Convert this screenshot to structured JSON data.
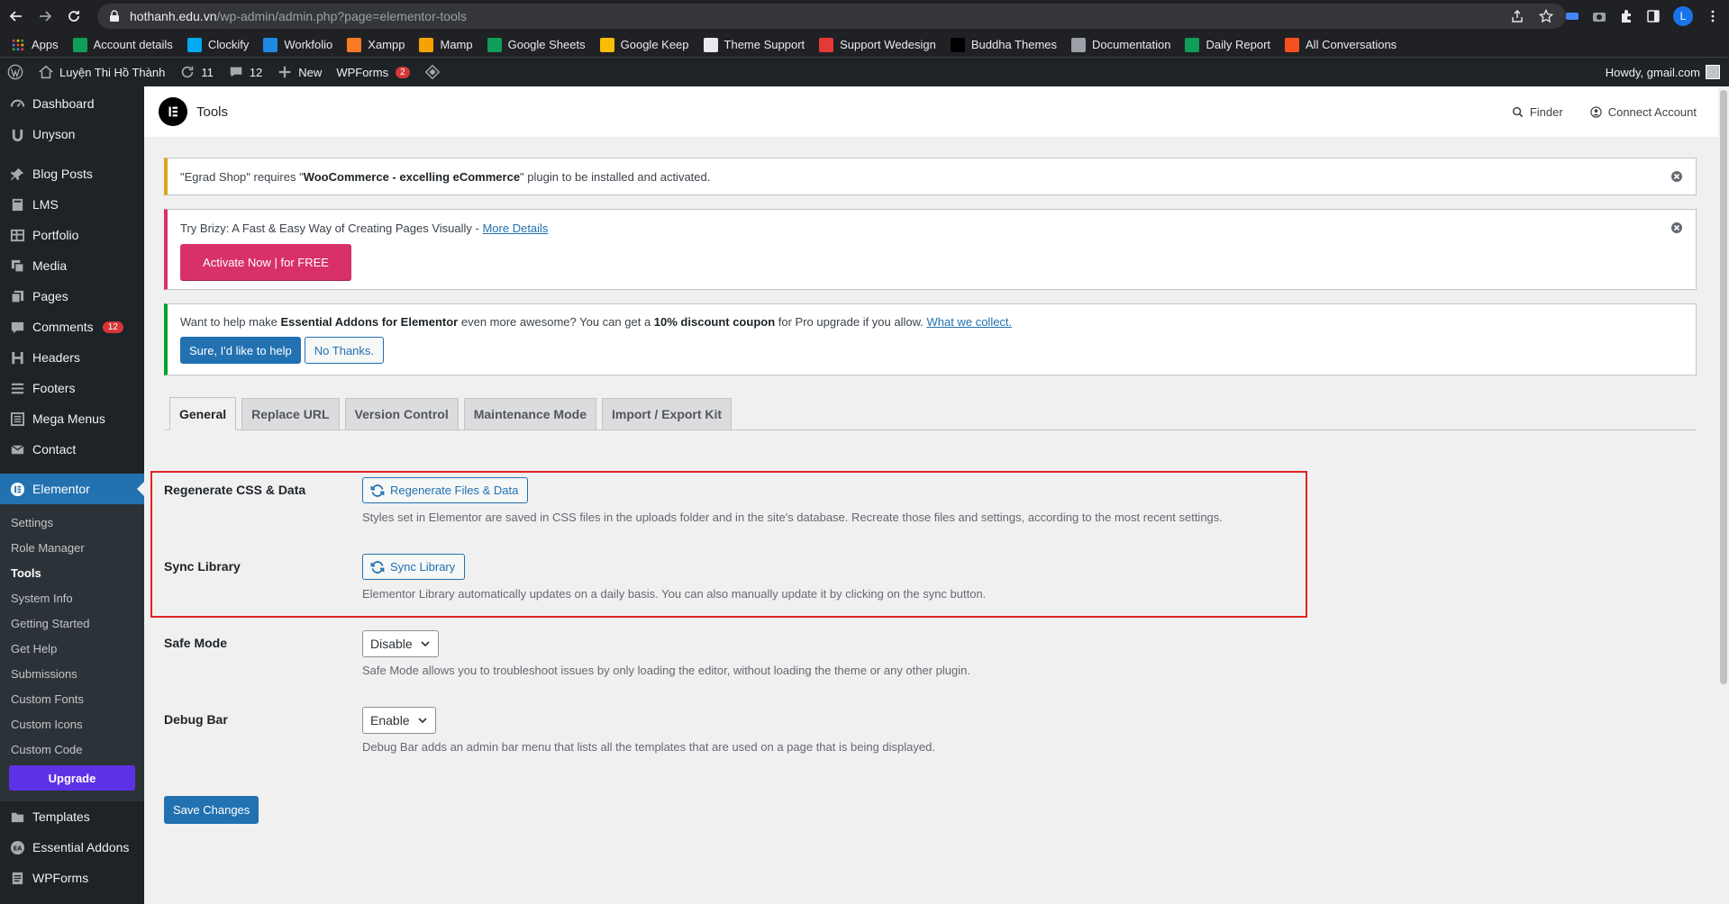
{
  "browser": {
    "url_host": "hothanh.edu.vn",
    "url_path": "/wp-admin/admin.php?page=elementor-tools",
    "profile_initial": "L"
  },
  "bookmarks": [
    {
      "label": "Apps",
      "icon": "apps-grid-icon",
      "color": "#ea4335"
    },
    {
      "label": "Account details",
      "icon": "sheets-icon",
      "color": "#0f9d58"
    },
    {
      "label": "Clockify",
      "icon": "clockify-icon",
      "color": "#03a9f4"
    },
    {
      "label": "Workfolio",
      "icon": "workfolio-icon",
      "color": "#1e88e5"
    },
    {
      "label": "Xampp",
      "icon": "xampp-icon",
      "color": "#fb7a24"
    },
    {
      "label": "Mamp",
      "icon": "mamp-icon",
      "color": "#f4a300"
    },
    {
      "label": "Google Sheets",
      "icon": "sheets-icon",
      "color": "#0f9d58"
    },
    {
      "label": "Google Keep",
      "icon": "keep-icon",
      "color": "#fbbc04"
    },
    {
      "label": "Theme Support",
      "icon": "wordpress-icon",
      "color": "#e8eaed"
    },
    {
      "label": "Support Wedesign",
      "icon": "wedesign-icon",
      "color": "#e53935"
    },
    {
      "label": "Buddha Themes",
      "icon": "buddha-icon",
      "color": "#000000"
    },
    {
      "label": "Documentation",
      "icon": "globe-icon",
      "color": "#9aa0a6"
    },
    {
      "label": "Daily Report",
      "icon": "sheets-icon",
      "color": "#0f9d58"
    },
    {
      "label": "All Conversations",
      "icon": "chat-icon",
      "color": "#f4511e"
    }
  ],
  "adminbar": {
    "site_name": "Luyện Thi Hồ Thành",
    "updates_count": "11",
    "comments_count": "12",
    "new_label": "New",
    "wpforms_label": "WPForms",
    "wpforms_badge": "2",
    "howdy": "Howdy, gmail.com"
  },
  "sidebar": {
    "items_top": [
      {
        "label": "Dashboard",
        "icon": "dashboard-icon"
      },
      {
        "label": "Unyson",
        "icon": "unyson-icon"
      }
    ],
    "items_mid": [
      {
        "label": "Blog Posts",
        "icon": "pin-icon"
      },
      {
        "label": "LMS",
        "icon": "book-icon"
      },
      {
        "label": "Portfolio",
        "icon": "portfolio-icon"
      },
      {
        "label": "Media",
        "icon": "media-icon"
      },
      {
        "label": "Pages",
        "icon": "pages-icon"
      },
      {
        "label": "Comments",
        "icon": "comments-icon",
        "badge": "12"
      },
      {
        "label": "Headers",
        "icon": "header-icon"
      },
      {
        "label": "Footers",
        "icon": "footer-icon"
      },
      {
        "label": "Mega Menus",
        "icon": "menu-icon"
      },
      {
        "label": "Contact",
        "icon": "mail-icon"
      }
    ],
    "active": {
      "label": "Elementor",
      "icon": "elementor-icon"
    },
    "submenu": [
      "Settings",
      "Role Manager",
      "Tools",
      "System Info",
      "Getting Started",
      "Get Help",
      "Submissions",
      "Custom Fonts",
      "Custom Icons",
      "Custom Code"
    ],
    "submenu_current": "Tools",
    "upgrade_label": "Upgrade",
    "items_bottom": [
      {
        "label": "Templates",
        "icon": "folder-icon"
      },
      {
        "label": "Essential Addons",
        "icon": "ea-icon"
      },
      {
        "label": "WPForms",
        "icon": "wpforms-icon"
      }
    ]
  },
  "header": {
    "title": "Tools",
    "finder_label": "Finder",
    "connect_label": "Connect Account"
  },
  "notices": {
    "woo": {
      "pre": "\"Egrad Shop\" requires \"",
      "bold": "WooCommerce - excelling eCommerce",
      "post": "\" plugin to be installed and activated."
    },
    "brizy": {
      "text": "Try Brizy: A Fast & Easy Way of Creating Pages Visually - ",
      "link": "More Details",
      "button": "Activate Now | for FREE"
    },
    "ea": {
      "t1": "Want to help make ",
      "b1": "Essential Addons for Elementor",
      "t2": " even more awesome? You can get a ",
      "b2": "10% discount coupon",
      "t3": " for Pro upgrade if you allow. ",
      "link": "What we collect.",
      "yes": "Sure, I'd like to help",
      "no": "No Thanks."
    }
  },
  "tabs": [
    "General",
    "Replace URL",
    "Version Control",
    "Maintenance Mode",
    "Import / Export Kit"
  ],
  "active_tab": "General",
  "settings": {
    "regenerate": {
      "label": "Regenerate CSS & Data",
      "button": "Regenerate Files & Data",
      "desc": "Styles set in Elementor are saved in CSS files in the uploads folder and in the site's database. Recreate those files and settings, according to the most recent settings."
    },
    "sync": {
      "label": "Sync Library",
      "button": "Sync Library",
      "desc": "Elementor Library automatically updates on a daily basis. You can also manually update it by clicking on the sync button."
    },
    "safe_mode": {
      "label": "Safe Mode",
      "value": "Disable",
      "desc": "Safe Mode allows you to troubleshoot issues by only loading the editor, without loading the theme or any other plugin."
    },
    "debug_bar": {
      "label": "Debug Bar",
      "value": "Enable",
      "desc": "Debug Bar adds an admin bar menu that lists all the templates that are used on a page that is being displayed."
    }
  },
  "save_label": "Save Changes",
  "colors": {
    "wp_blue": "#2271b1",
    "highlight_red": "#e02424",
    "brizy_pink": "#d8306b",
    "upgrade_purple": "#5c32e6"
  }
}
